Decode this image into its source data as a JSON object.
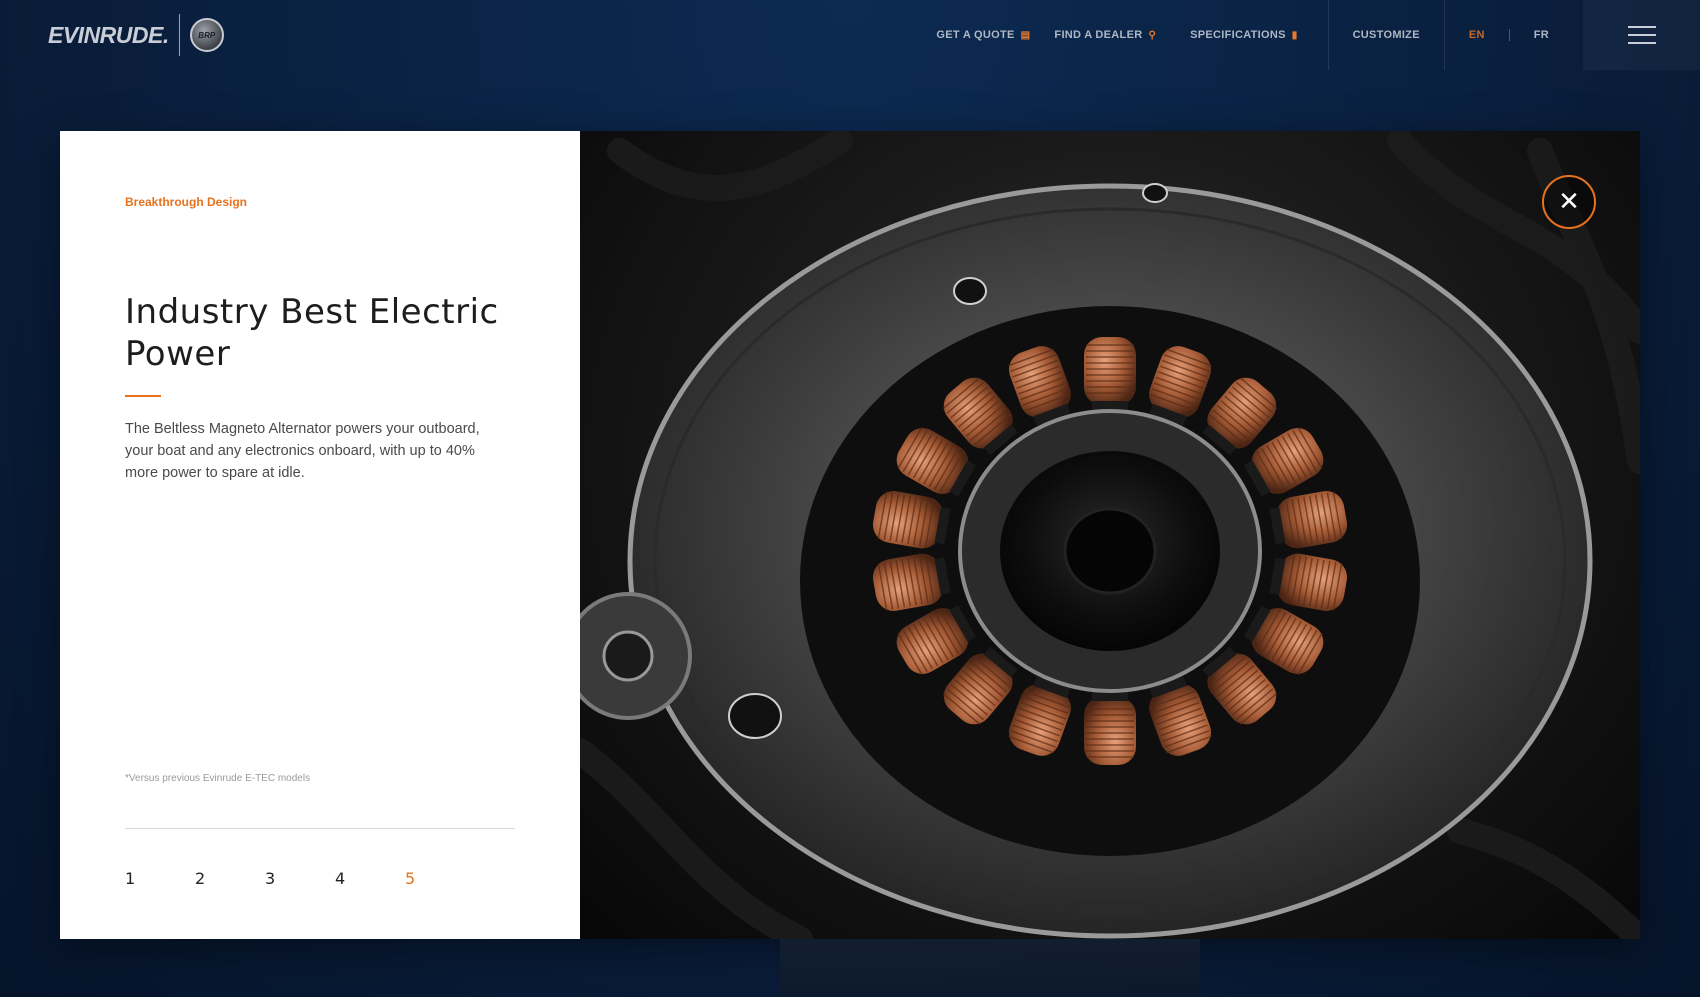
{
  "brand": {
    "wordmark": "EVINRUDE.",
    "badge": "BRP"
  },
  "nav": {
    "get_quote": "GET A QUOTE",
    "find_dealer": "FIND A DEALER",
    "specifications": "SPECIFICATIONS",
    "customize": "CUSTOMIZE",
    "lang_en": "EN",
    "lang_fr": "FR",
    "icons": {
      "get_quote": "document-icon",
      "find_dealer": "map-pin-icon",
      "specifications": "file-icon",
      "menu": "hamburger-icon"
    }
  },
  "modal": {
    "eyebrow": "Breakthrough Design",
    "title": "Industry Best Electric Power",
    "body": "The Beltless Magneto Alternator powers your outboard, your boat and any electronics onboard, with up to 40% more power to spare at idle.",
    "footnote": "*Versus previous Evinrude E-TEC models",
    "pages": [
      "1",
      "2",
      "3",
      "4",
      "5"
    ],
    "active_page": "5",
    "close_symbol": "✕",
    "image_subject": "alternator-stator"
  },
  "colors": {
    "accent": "#e8721c",
    "background": "#0a1f3e",
    "panel": "#ffffff"
  }
}
